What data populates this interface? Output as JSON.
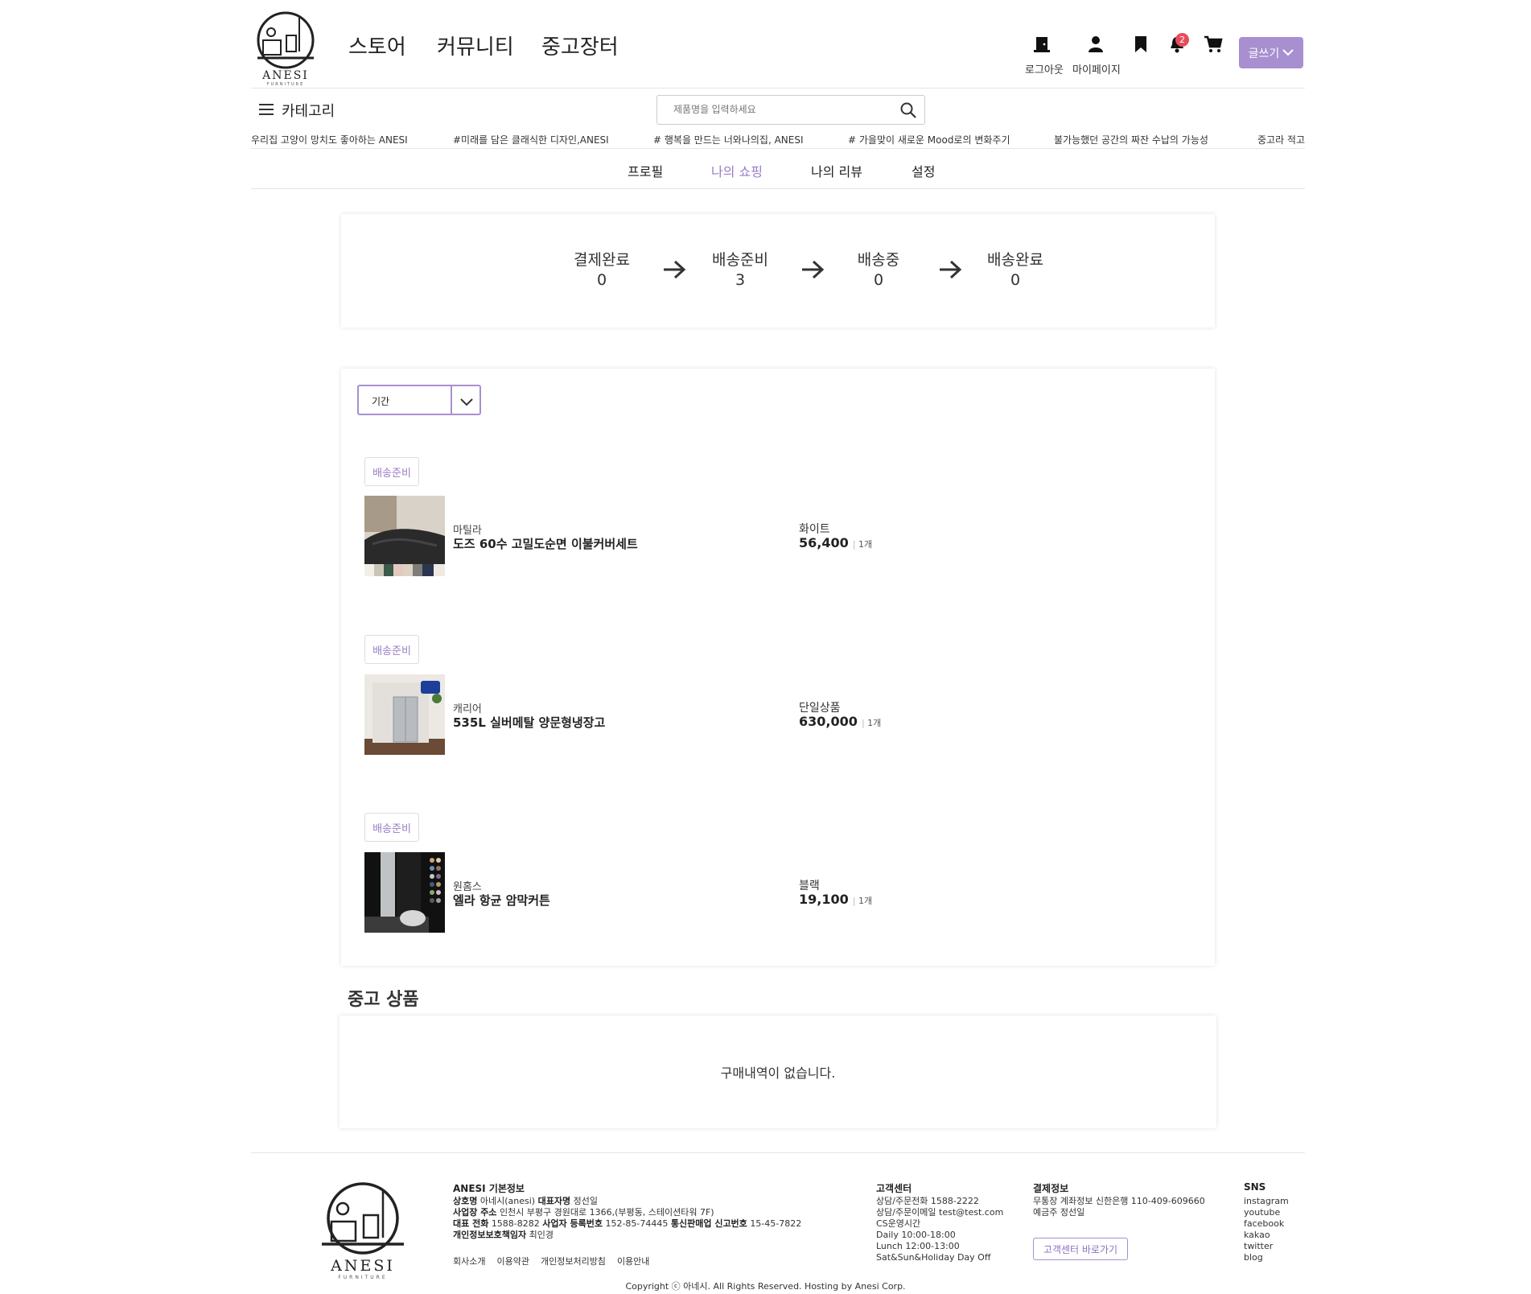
{
  "brand": {
    "name": "ANESI",
    "sub": "FURNITURE"
  },
  "nav": [
    "스토어",
    "커뮤니티",
    "중고장터"
  ],
  "header": {
    "logout": "로그아웃",
    "mypage": "마이페이지",
    "notif_count": "2",
    "write": "글쓰기"
  },
  "category": "카테고리",
  "search": {
    "placeholder": "제품명을 입력하세요"
  },
  "marquee": [
    "우리집 고양이 망치도 좋아하는 ANESI",
    "#미래를 담은 클래식한 디자인,ANESI",
    "# 행복을 만드는 너와나의집, ANESI",
    "# 가을맞이 새로운 Mood로의 변화주기",
    "불가능했던 공간의 짜잔 수납의 가능성",
    "중고라 적고 새"
  ],
  "tabs": [
    "프로필",
    "나의 쇼핑",
    "나의 리뷰",
    "설정"
  ],
  "active_tab": "나의 쇼핑",
  "steps": [
    {
      "label": "결제완료",
      "count": "0"
    },
    {
      "label": "배송준비",
      "count": "3"
    },
    {
      "label": "배송중",
      "count": "0"
    },
    {
      "label": "배송완료",
      "count": "0"
    }
  ],
  "filter": {
    "label": "기간"
  },
  "orders": [
    {
      "status": "배송준비",
      "brand": "마틸라",
      "name": "도즈 60수 고밀도순면 이불커버세트",
      "option": "화이트",
      "price": "56,400",
      "qty": "1개"
    },
    {
      "status": "배송준비",
      "brand": "캐리어",
      "name": "535L 실버메탈 양문형냉장고",
      "option": "단일상품",
      "price": "630,000",
      "qty": "1개"
    },
    {
      "status": "배송준비",
      "brand": "원홈스",
      "name": "엘라 항균 암막커튼",
      "option": "블랙",
      "price": "19,100",
      "qty": "1개"
    }
  ],
  "used": {
    "title": "중고 상품",
    "empty": "구매내역이 없습니다."
  },
  "footer": {
    "info_title": "ANESI 기본정보",
    "l1a": "상호명",
    "l1b": "아네시(anesi)",
    "l1c": "대표자명",
    "l1d": "정선일",
    "l2a": "사업장 주소",
    "l2b": "인천시 부평구 경원대로 1366,(부평동, 스테이션타워 7F)",
    "l3a": "대표 전화",
    "l3b": "1588-8282",
    "l3c": "사업자 등록번호",
    "l3d": "152-85-74445",
    "l3e": "통신판매업 신고번호",
    "l3f": "15-45-7822",
    "l4a": "개인정보보호책임자",
    "l4b": "최인경",
    "links": [
      "회사소개",
      "이용약관",
      "개인정보처리방침",
      "이용안내"
    ],
    "cs_title": "고객센터",
    "cs": [
      "상담/주문전화 1588-2222",
      "상담/주문이메일 test@test.com",
      "CS운영시간",
      "Daily 10:00-18:00",
      "Lunch 12:00-13:00",
      "Sat&Sun&Holiday Day Off"
    ],
    "pay_title": "결제정보",
    "pay": [
      "무통장 계좌정보 신한은행 110-409-609660",
      "예금주 정선일"
    ],
    "cs_button": "고객센터 바로가기",
    "sns_title": "SNS",
    "sns": [
      "instagram",
      "youtube",
      "facebook",
      "kakao",
      "twitter",
      "blog"
    ],
    "copyright": "Copyright ⓒ 아네시. All Rights Reserved. Hosting by Anesi Corp."
  },
  "colors": {
    "accent": "#a88fd0",
    "badge": "#e74c5b"
  }
}
